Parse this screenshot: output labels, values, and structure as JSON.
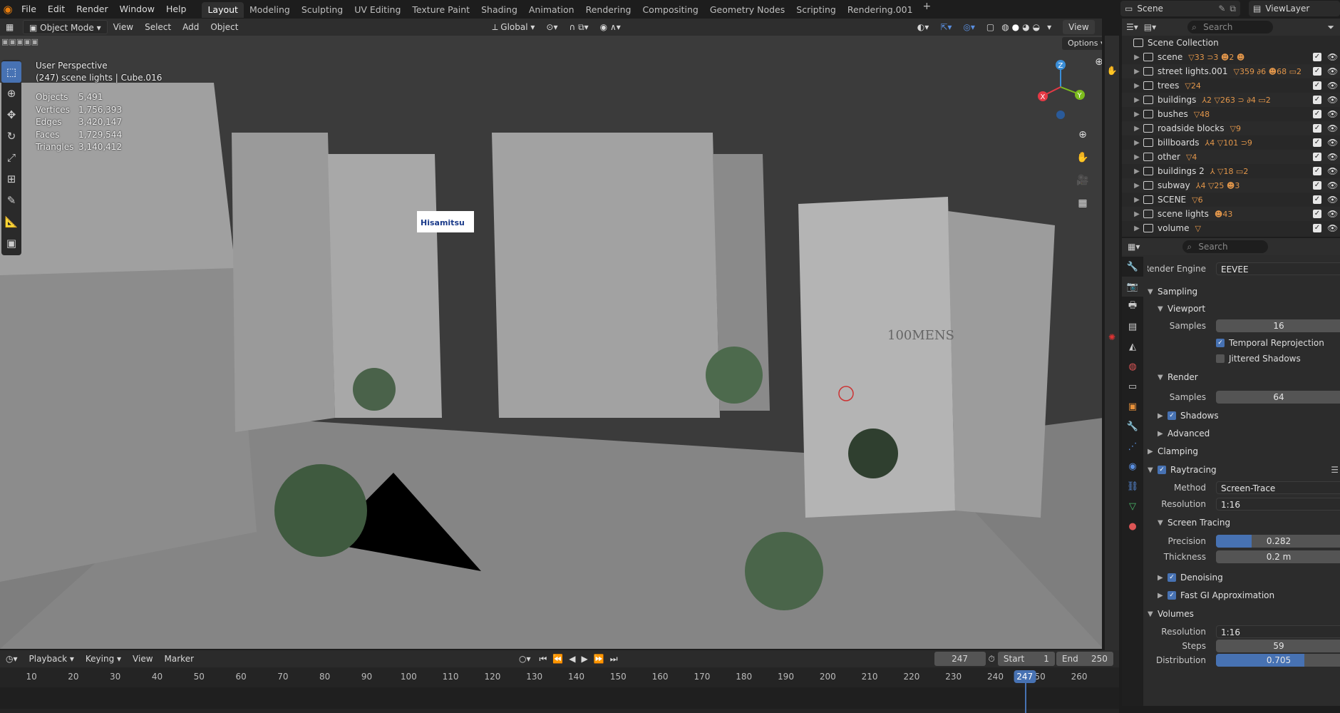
{
  "menubar": {
    "items": [
      "File",
      "Edit",
      "Render",
      "Window",
      "Help"
    ],
    "workspaces": [
      "Layout",
      "Modeling",
      "Sculpting",
      "UV Editing",
      "Texture Paint",
      "Shading",
      "Animation",
      "Rendering",
      "Compositing",
      "Geometry Nodes",
      "Scripting",
      "Rendering.001"
    ],
    "active_workspace": "Layout",
    "add_tab": "+",
    "scene": "Scene",
    "view_layer": "ViewLayer"
  },
  "viewport_header": {
    "mode": "Object Mode",
    "menus": [
      "View",
      "Select",
      "Add",
      "Object"
    ],
    "orientation": "Global",
    "options": "Options",
    "side_label": "View"
  },
  "overlay": {
    "view_name": "User Perspective",
    "context": "(247) scene lights | Cube.016",
    "stats": [
      {
        "label": "Objects",
        "value": "5,491"
      },
      {
        "label": "Vertices",
        "value": "1,756,393"
      },
      {
        "label": "Edges",
        "value": "3,420,147"
      },
      {
        "label": "Faces",
        "value": "1,729,544"
      },
      {
        "label": "Triangles",
        "value": "3,140,412"
      }
    ]
  },
  "gizmo": {
    "x": "X",
    "y": "Y",
    "z": "Z"
  },
  "scene_signs": {
    "sign1": "Hisamitsu",
    "sign2": "100MENS"
  },
  "timeline": {
    "menus": [
      "Playback",
      "Keying",
      "View",
      "Marker"
    ],
    "current_frame": "247",
    "start_label": "Start",
    "start": "1",
    "end_label": "End",
    "end": "250",
    "ticks": [
      "10",
      "20",
      "30",
      "40",
      "50",
      "60",
      "70",
      "80",
      "90",
      "100",
      "110",
      "120",
      "130",
      "140",
      "150",
      "160",
      "170",
      "180",
      "190",
      "200",
      "210",
      "220",
      "230",
      "240",
      "250",
      "260"
    ]
  },
  "outliner": {
    "search_placeholder": "Search",
    "root": "Scene Collection",
    "collections": [
      {
        "name": "scene",
        "tags": "▽33 ⊃3 ☻2 ☻"
      },
      {
        "name": "street lights.001",
        "tags": "▽359 ∂6 ☻68 ▭2"
      },
      {
        "name": "trees",
        "tags": "▽24"
      },
      {
        "name": "buildings",
        "tags": "⅄2 ▽263 ⊃ ∂4 ▭2"
      },
      {
        "name": "bushes",
        "tags": "▽48"
      },
      {
        "name": "roadside blocks",
        "tags": "▽9"
      },
      {
        "name": "billboards",
        "tags": "⅄4 ▽101 ⊃9"
      },
      {
        "name": "other",
        "tags": "▽4"
      },
      {
        "name": "buildings 2",
        "tags": "⅄ ▽18 ▭2"
      },
      {
        "name": "subway",
        "tags": "⅄4 ▽25 ☻3"
      },
      {
        "name": "SCENE",
        "tags": "▽6"
      },
      {
        "name": "scene lights",
        "tags": "☻43"
      },
      {
        "name": "volume",
        "tags": "▽"
      }
    ]
  },
  "properties": {
    "search_placeholder": "Search",
    "render_engine_label": "Render Engine",
    "render_engine": "EEVEE",
    "sampling": "Sampling",
    "viewport": "Viewport",
    "samples_label": "Samples",
    "viewport_samples": "16",
    "temporal_reprojection": "Temporal Reprojection",
    "jittered_shadows": "Jittered Shadows",
    "render": "Render",
    "render_samples": "64",
    "shadows": "Shadows",
    "advanced": "Advanced",
    "clamping": "Clamping",
    "raytracing": "Raytracing",
    "method_label": "Method",
    "method": "Screen-Trace",
    "resolution_label": "Resolution",
    "resolution": "1:16",
    "screen_tracing": "Screen Tracing",
    "precision_label": "Precision",
    "precision": "0.282",
    "precision_fraction": 0.282,
    "thickness_label": "Thickness",
    "thickness": "0.2 m",
    "denoising": "Denoising",
    "fast_gi": "Fast GI Approximation",
    "volumes": "Volumes",
    "vol_resolution": "1:16",
    "steps_label": "Steps",
    "steps": "59",
    "distribution_label": "Distribution",
    "distribution": "0.705",
    "distribution_fraction": 0.705
  },
  "colors": {
    "accent": "#4772b3",
    "header": "#2e2e2e",
    "panel": "#2c2c2c",
    "viewport": "#3d3d3d",
    "x_axis": "#e53945",
    "y_axis": "#7cbc1e",
    "z_axis": "#3a8ed8"
  }
}
